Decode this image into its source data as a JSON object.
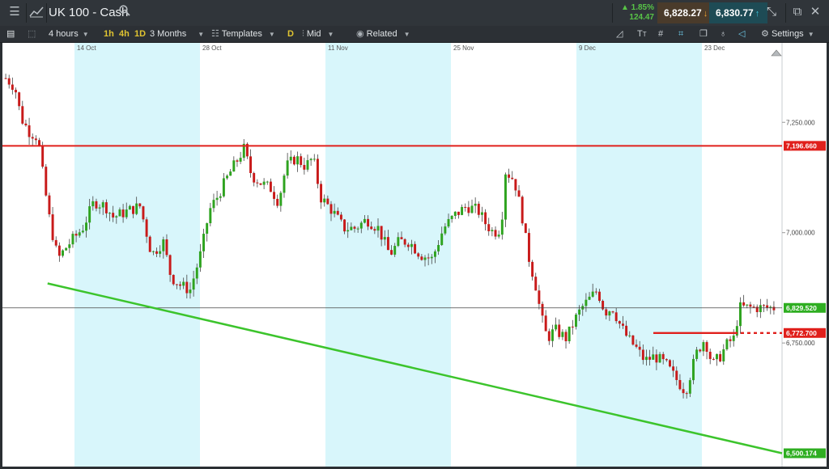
{
  "header": {
    "instrument": "UK 100 - Cash",
    "change_percent": "1.85%",
    "change_points": "124.47",
    "sell_price": "6,828.27",
    "buy_price": "6,830.77"
  },
  "toolbar": {
    "interval": "4 hours",
    "quick_1h": "1h",
    "quick_4h": "4h",
    "quick_1d": "1D",
    "range": "3 Months",
    "templates": "Templates",
    "d_button": "D",
    "price_type": "Mid",
    "related": "Related",
    "settings": "Settings"
  },
  "chart_data": {
    "type": "candlestick",
    "x_ticks": [
      "14 Oct",
      "28 Oct",
      "11 Nov",
      "25 Nov",
      "9 Dec",
      "23 Dec"
    ],
    "y_ticks": [
      "7,250.000",
      "7,000.000",
      "6,750.000"
    ],
    "price_tags": [
      {
        "label": "7,196.660",
        "value": 7196.66,
        "color": "#e0201c"
      },
      {
        "label": "6,829.520",
        "value": 6829.52,
        "color": "#2eae21"
      },
      {
        "label": "6,772.700",
        "value": 6772.7,
        "color": "#e0201c"
      },
      {
        "label": "6,500.174",
        "value": 6500.174,
        "color": "#2eae21"
      }
    ],
    "horizontal_lines": [
      {
        "value": 7196.66,
        "color": "#e0201c",
        "style": "solid"
      },
      {
        "value": 6829.52,
        "color": "#444444",
        "style": "thin"
      },
      {
        "value": 6772.7,
        "color": "#e0201c",
        "style": "segment-then-dotted"
      }
    ],
    "trendline": {
      "from_date": "11 Oct",
      "from_value": 6885,
      "to_date": "31 Dec",
      "to_value": 6500.174,
      "color": "#3cc42c"
    },
    "shaded_weeks": [
      "14 Oct",
      "11 Nov",
      "9 Dec"
    ],
    "y_range": [
      6470,
      7430
    ],
    "path_points": [
      [
        0,
        7350
      ],
      [
        0.012,
        7330
      ],
      [
        0.02,
        7260
      ],
      [
        0.03,
        7230
      ],
      [
        0.042,
        7215
      ],
      [
        0.05,
        7110
      ],
      [
        0.058,
        7020
      ],
      [
        0.068,
        6940
      ],
      [
        0.08,
        6970
      ],
      [
        0.09,
        6990
      ],
      [
        0.1,
        7010
      ],
      [
        0.115,
        7070
      ],
      [
        0.13,
        7060
      ],
      [
        0.14,
        7035
      ],
      [
        0.16,
        7050
      ],
      [
        0.175,
        7060
      ],
      [
        0.19,
        6950
      ],
      [
        0.205,
        6980
      ],
      [
        0.215,
        6900
      ],
      [
        0.228,
        6880
      ],
      [
        0.24,
        6870
      ],
      [
        0.255,
        6960
      ],
      [
        0.265,
        7050
      ],
      [
        0.275,
        7080
      ],
      [
        0.29,
        7130
      ],
      [
        0.3,
        7160
      ],
      [
        0.31,
        7190
      ],
      [
        0.32,
        7130
      ],
      [
        0.33,
        7115
      ],
      [
        0.345,
        7100
      ],
      [
        0.355,
        7070
      ],
      [
        0.365,
        7150
      ],
      [
        0.378,
        7170
      ],
      [
        0.39,
        7150
      ],
      [
        0.4,
        7170
      ],
      [
        0.41,
        7080
      ],
      [
        0.425,
        7050
      ],
      [
        0.44,
        7010
      ],
      [
        0.455,
        7010
      ],
      [
        0.47,
        7030
      ],
      [
        0.485,
        7010
      ],
      [
        0.5,
        6950
      ],
      [
        0.512,
        6980
      ],
      [
        0.525,
        6980
      ],
      [
        0.54,
        6950
      ],
      [
        0.555,
        6940
      ],
      [
        0.57,
        7010
      ],
      [
        0.585,
        7040
      ],
      [
        0.6,
        7060
      ],
      [
        0.615,
        7050
      ],
      [
        0.625,
        7020
      ],
      [
        0.635,
        7000
      ],
      [
        0.645,
        7010
      ],
      [
        0.65,
        7140
      ],
      [
        0.662,
        7120
      ],
      [
        0.672,
        7040
      ],
      [
        0.68,
        6950
      ],
      [
        0.69,
        6880
      ],
      [
        0.697,
        6810
      ],
      [
        0.705,
        6760
      ],
      [
        0.715,
        6780
      ],
      [
        0.73,
        6760
      ],
      [
        0.74,
        6800
      ],
      [
        0.75,
        6830
      ],
      [
        0.76,
        6850
      ],
      [
        0.77,
        6870
      ],
      [
        0.78,
        6820
      ],
      [
        0.79,
        6830
      ],
      [
        0.8,
        6790
      ],
      [
        0.81,
        6760
      ],
      [
        0.82,
        6740
      ],
      [
        0.832,
        6710
      ],
      [
        0.845,
        6720
      ],
      [
        0.86,
        6700
      ],
      [
        0.872,
        6670
      ],
      [
        0.885,
        6640
      ],
      [
        0.893,
        6690
      ],
      [
        0.9,
        6730
      ],
      [
        0.91,
        6760
      ],
      [
        0.92,
        6700
      ],
      [
        0.93,
        6720
      ],
      [
        0.94,
        6750
      ],
      [
        0.948,
        6760
      ],
      [
        0.955,
        6830
      ]
    ]
  }
}
